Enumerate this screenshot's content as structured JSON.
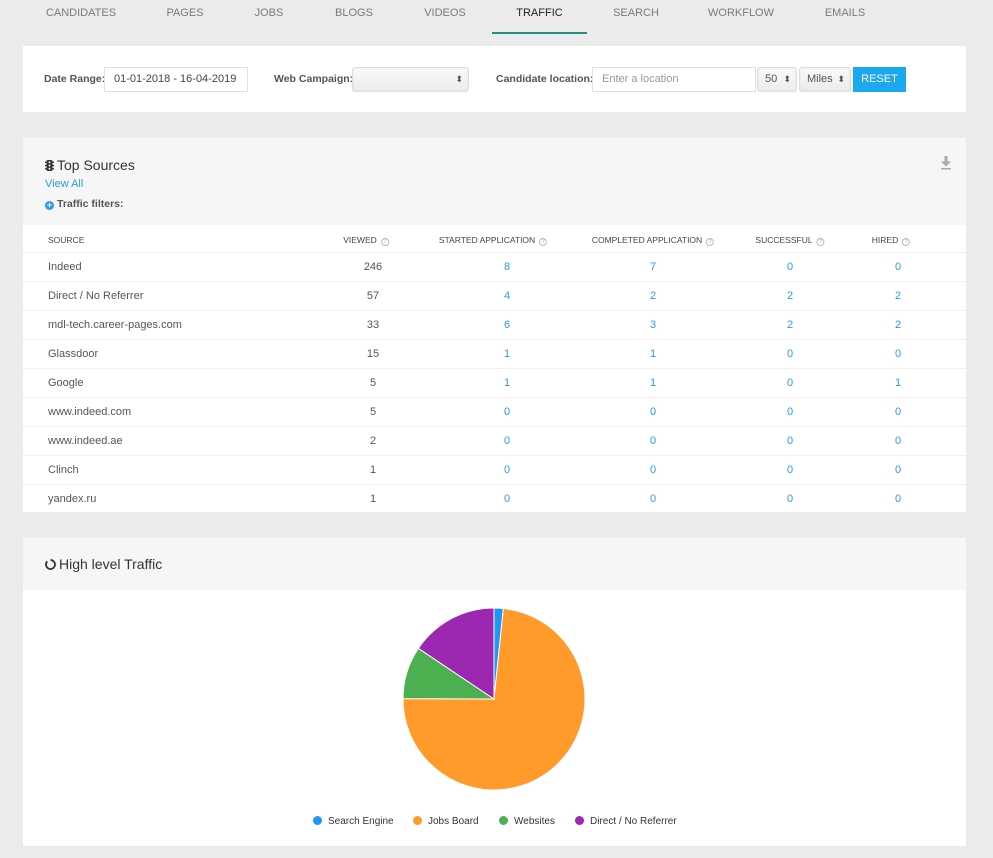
{
  "tabs": [
    {
      "label": "CANDIDATES",
      "active": false
    },
    {
      "label": "PAGES",
      "active": false
    },
    {
      "label": "JOBS",
      "active": false
    },
    {
      "label": "BLOGS",
      "active": false
    },
    {
      "label": "VIDEOS",
      "active": false
    },
    {
      "label": "TRAFFIC",
      "active": true
    },
    {
      "label": "SEARCH",
      "active": false
    },
    {
      "label": "WORKFLOW",
      "active": false
    },
    {
      "label": "EMAILS",
      "active": false
    }
  ],
  "filters": {
    "date_range_label": "Date Range:",
    "date_range_value": "01-01-2018 - 16-04-2019",
    "web_campaign_label": "Web Campaign:",
    "web_campaign_value": "",
    "location_label": "Candidate location:",
    "location_placeholder": "Enter a location",
    "radius_value": "50",
    "unit_value": "Miles",
    "reset_label": "RESET",
    "select_arrows": "⬍"
  },
  "top_sources": {
    "title": "Top Sources",
    "icon": "traffic-light-icon",
    "view_all": "View All",
    "traffic_filters": "Traffic filters:",
    "columns": [
      "SOURCE",
      "VIEWED",
      "STARTED APPLICATION",
      "COMPLETED APPLICATION",
      "SUCCESSFUL",
      "HIRED"
    ],
    "help_glyph": "?",
    "rows": [
      {
        "source": "Indeed",
        "viewed": "246",
        "started": "8",
        "completed": "7",
        "successful": "0",
        "hired": "0"
      },
      {
        "source": "Direct / No Referrer",
        "viewed": "57",
        "started": "4",
        "completed": "2",
        "successful": "2",
        "hired": "2"
      },
      {
        "source": "mdl-tech.career-pages.com",
        "viewed": "33",
        "started": "6",
        "completed": "3",
        "successful": "2",
        "hired": "2"
      },
      {
        "source": "Glassdoor",
        "viewed": "15",
        "started": "1",
        "completed": "1",
        "successful": "0",
        "hired": "0"
      },
      {
        "source": "Google",
        "viewed": "5",
        "started": "1",
        "completed": "1",
        "successful": "0",
        "hired": "1"
      },
      {
        "source": "www.indeed.com",
        "viewed": "5",
        "started": "0",
        "completed": "0",
        "successful": "0",
        "hired": "0"
      },
      {
        "source": "www.indeed.ae",
        "viewed": "2",
        "started": "0",
        "completed": "0",
        "successful": "0",
        "hired": "0"
      },
      {
        "source": "Clinch",
        "viewed": "1",
        "started": "0",
        "completed": "0",
        "successful": "0",
        "hired": "0"
      },
      {
        "source": "yandex.ru",
        "viewed": "1",
        "started": "0",
        "completed": "0",
        "successful": "0",
        "hired": "0"
      }
    ]
  },
  "high_level_traffic": {
    "title": "High level Traffic",
    "icon": "circle-notch-icon"
  },
  "chart_data": {
    "type": "pie",
    "title": "High level Traffic",
    "categories": [
      "Search Engine",
      "Jobs Board",
      "Websites",
      "Direct / No Referrer"
    ],
    "values": [
      6,
      268,
      34,
      57
    ],
    "colors": [
      "#2196f3",
      "#ff9a2b",
      "#4caf50",
      "#9c27b0"
    ],
    "legend": "bottom",
    "start_angle": "top, clockwise"
  }
}
